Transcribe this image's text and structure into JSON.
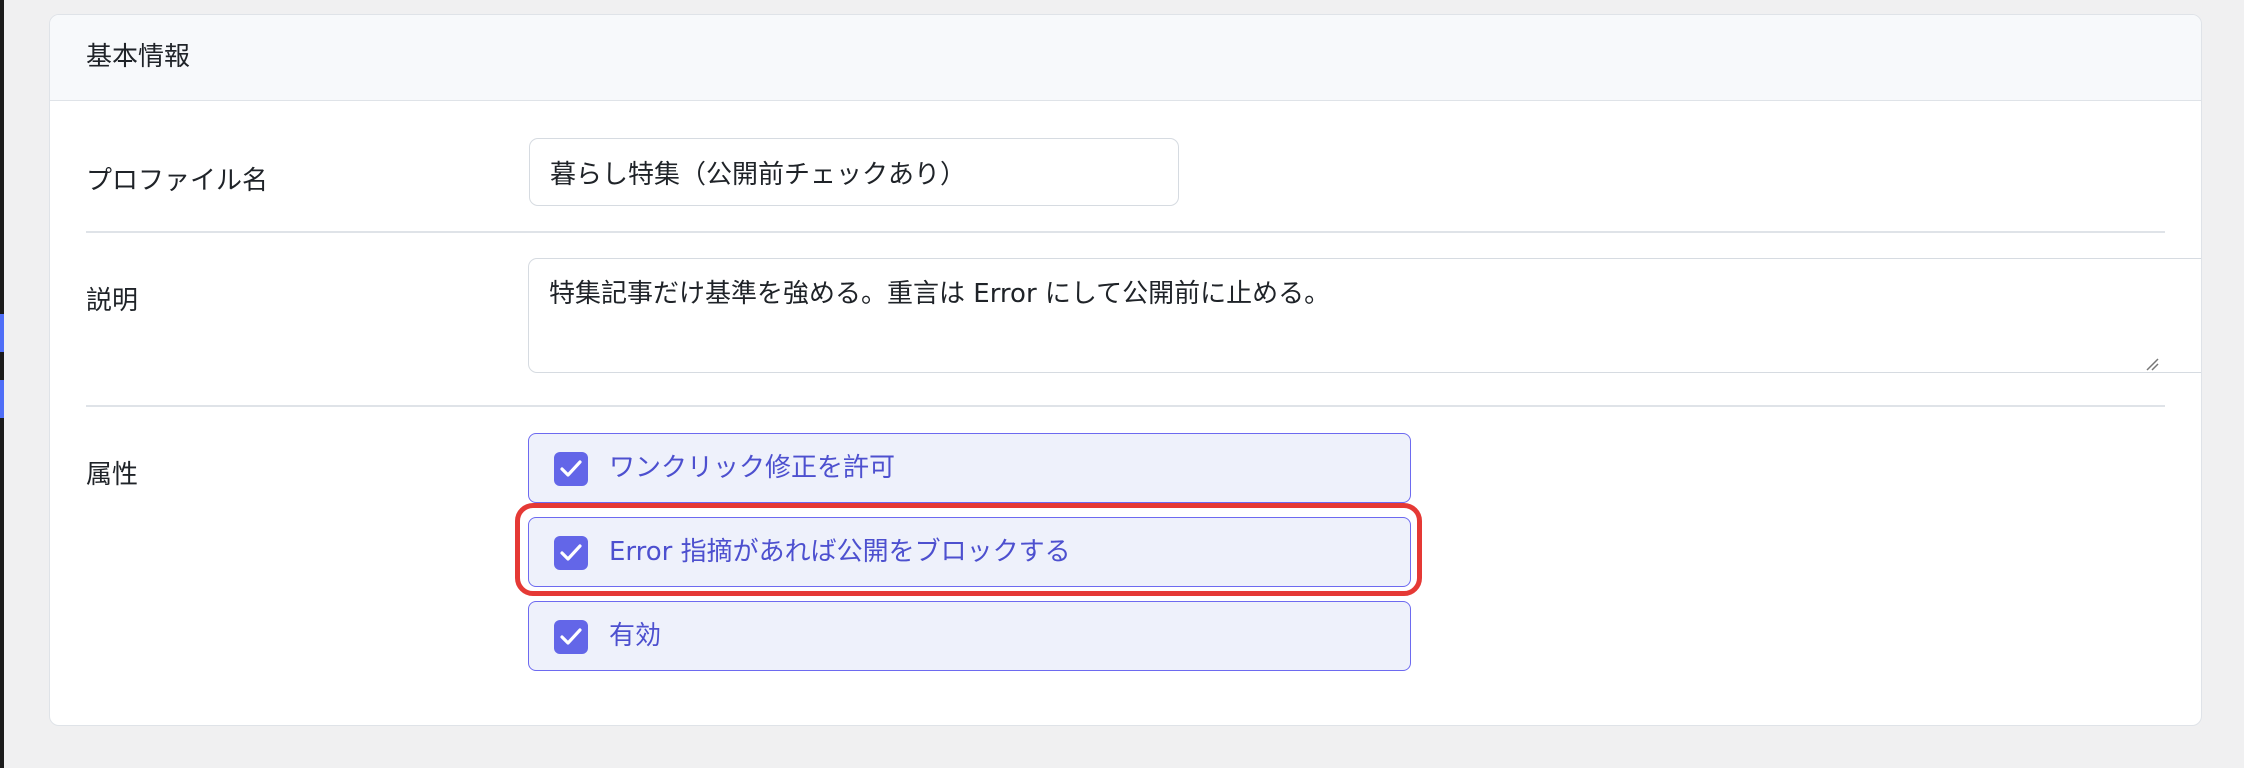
{
  "section": {
    "title": "基本情報"
  },
  "profile_name": {
    "label": "プロファイル名",
    "value": "暮らし特集（公開前チェックあり）"
  },
  "description": {
    "label": "説明",
    "value": "特集記事だけ基準を強める。重言は Error にして公開前に止める。"
  },
  "attributes": {
    "label": "属性",
    "options": [
      {
        "label": "ワンクリック修正を許可",
        "checked": true
      },
      {
        "label": "Error 指摘があれば公開をブロックする",
        "checked": true,
        "highlighted": true
      },
      {
        "label": "有効",
        "checked": true
      }
    ]
  },
  "icons": {
    "checkbox": "check-icon",
    "resize": "resize-grip-icon"
  },
  "colors": {
    "accent": "#6366e8",
    "option_background": "#eef1fb",
    "highlight": "#e53935"
  }
}
